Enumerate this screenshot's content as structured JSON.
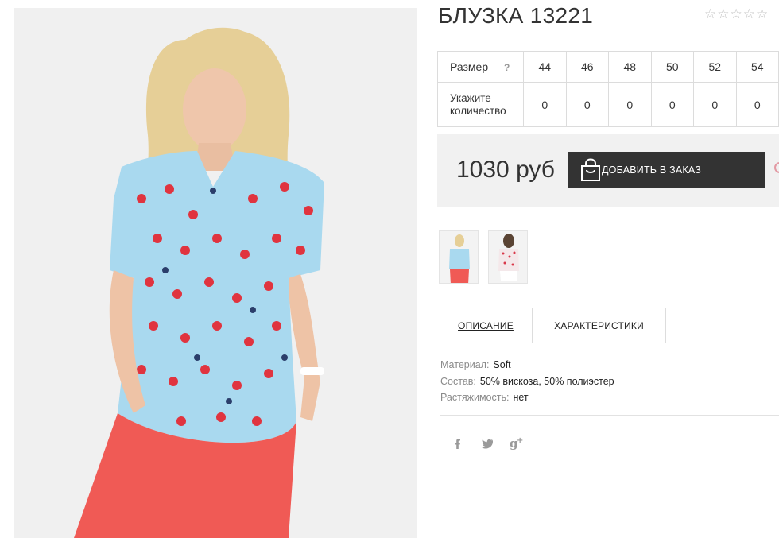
{
  "product": {
    "title": "БЛУЗКА 13221",
    "rating_stars": [
      "☆",
      "☆",
      "☆",
      "☆",
      "☆"
    ]
  },
  "size_table": {
    "size_label": "Размер",
    "help_icon": "?",
    "sizes": [
      "44",
      "46",
      "48",
      "50",
      "52",
      "54"
    ],
    "qty_label_line1": "Укажите",
    "qty_label_line2": "количество",
    "quantities": [
      "0",
      "0",
      "0",
      "0",
      "0",
      "0"
    ]
  },
  "order": {
    "price": "1030 руб",
    "add_button_label": "ДОБАВИТЬ В ЗАКАЗ"
  },
  "tabs": [
    {
      "label": "ОПИСАНИЕ",
      "active": false
    },
    {
      "label": "ХАРАКТЕРИСТИКИ",
      "active": true
    }
  ],
  "specs": [
    {
      "key": "Материал:",
      "value": "Soft"
    },
    {
      "key": "Состав:",
      "value": "50% вискоза, 50% полиэстер"
    },
    {
      "key": "Растяжимость:",
      "value": "нет"
    }
  ],
  "social_icons": [
    "facebook-icon",
    "twitter-icon",
    "google-plus-icon"
  ],
  "colors": {
    "button_bg": "#333333",
    "order_box_bg": "#f1f1f1",
    "blouse_blue": "#a9d9ef",
    "pants_red": "#f05a55"
  }
}
